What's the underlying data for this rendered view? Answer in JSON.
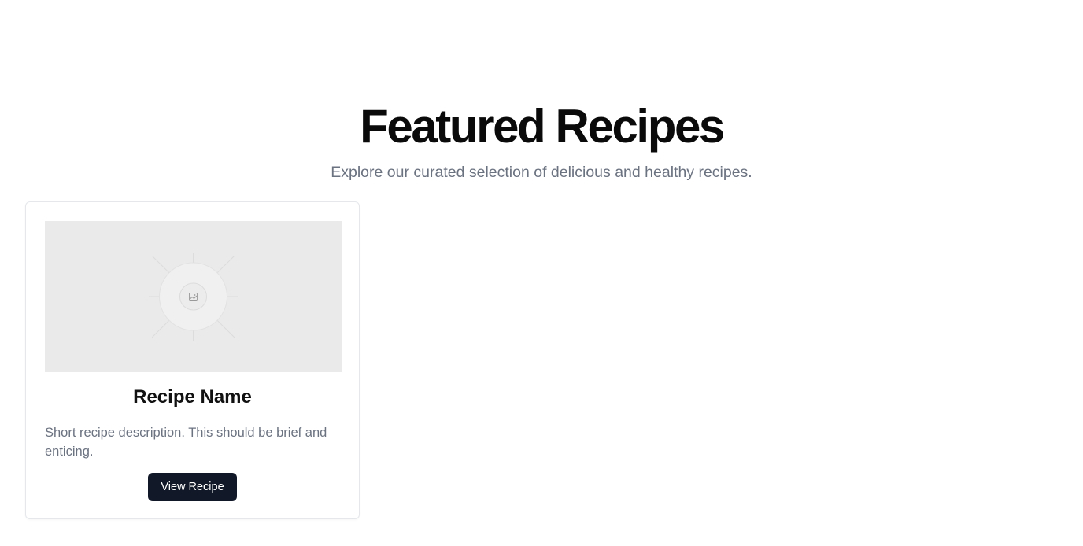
{
  "hero": {
    "title": "Featured Recipes",
    "subtitle": "Explore our curated selection of delicious and healthy recipes."
  },
  "recipes": [
    {
      "image_icon": "image-placeholder-icon",
      "name": "Recipe Name",
      "description": "Short recipe description. This should be brief and enticing.",
      "button_label": "View Recipe"
    }
  ],
  "colors": {
    "title": "#0a0a0a",
    "subtitle": "#6b7280",
    "button_bg": "#111827",
    "button_text": "#ffffff",
    "image_bg": "#eaeaea",
    "card_border": "#e5e7eb"
  }
}
